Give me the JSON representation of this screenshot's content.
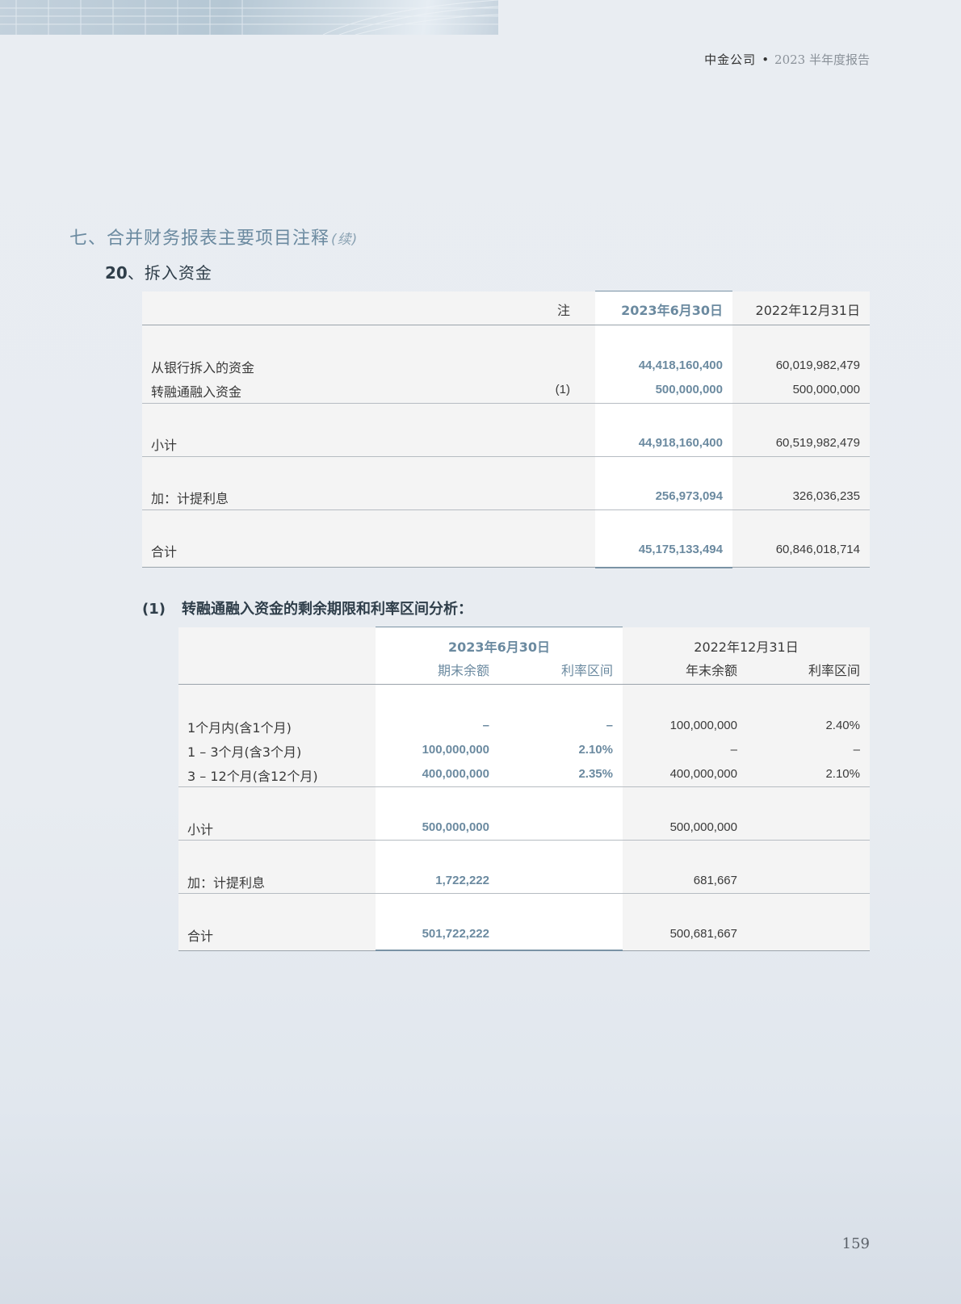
{
  "header": {
    "company": "中金公司",
    "report": "2023 半年度报告"
  },
  "section": {
    "title": "七、合并财务报表主要项目注释",
    "continued": "(续)"
  },
  "subsection": {
    "number": "20",
    "title": "、拆入资金"
  },
  "table1": {
    "headers": {
      "note": "注",
      "current": "2023年6月30日",
      "prior": "2022年12月31日"
    },
    "rows": [
      {
        "label": "从银行拆入的资金",
        "note": "",
        "current": "44,418,160,400",
        "prior": "60,019,982,479"
      },
      {
        "label": "转融通融入资金",
        "note": "(1)",
        "current": "500,000,000",
        "prior": "500,000,000"
      },
      {
        "label": "小计",
        "note": "",
        "current": "44,918,160,400",
        "prior": "60,519,982,479"
      },
      {
        "label": "加：计提利息",
        "note": "",
        "current": "256,973,094",
        "prior": "326,036,235"
      },
      {
        "label": "合计",
        "note": "",
        "current": "45,175,133,494",
        "prior": "60,846,018,714"
      }
    ]
  },
  "note1": {
    "number": "(1)",
    "title": "转融通融入资金的剩余期限和利率区间分析：",
    "headers": {
      "current": "2023年6月30日",
      "prior": "2022年12月31日",
      "current_balance": "期末余额",
      "current_rate": "利率区间",
      "prior_balance": "年末余额",
      "prior_rate": "利率区间"
    },
    "rows": [
      {
        "label": "1个月内(含1个月)",
        "cur_bal": "–",
        "cur_rate": "–",
        "pri_bal": "100,000,000",
        "pri_rate": "2.40%"
      },
      {
        "label": "1 – 3个月(含3个月)",
        "cur_bal": "100,000,000",
        "cur_rate": "2.10%",
        "pri_bal": "–",
        "pri_rate": "–"
      },
      {
        "label": "3 – 12个月(含12个月)",
        "cur_bal": "400,000,000",
        "cur_rate": "2.35%",
        "pri_bal": "400,000,000",
        "pri_rate": "2.10%"
      },
      {
        "label": "小计",
        "cur_bal": "500,000,000",
        "cur_rate": "",
        "pri_bal": "500,000,000",
        "pri_rate": ""
      },
      {
        "label": "加：计提利息",
        "cur_bal": "1,722,222",
        "cur_rate": "",
        "pri_bal": "681,667",
        "pri_rate": ""
      },
      {
        "label": "合计",
        "cur_bal": "501,722,222",
        "cur_rate": "",
        "pri_bal": "500,681,667",
        "pri_rate": ""
      }
    ]
  },
  "page_number": "159"
}
